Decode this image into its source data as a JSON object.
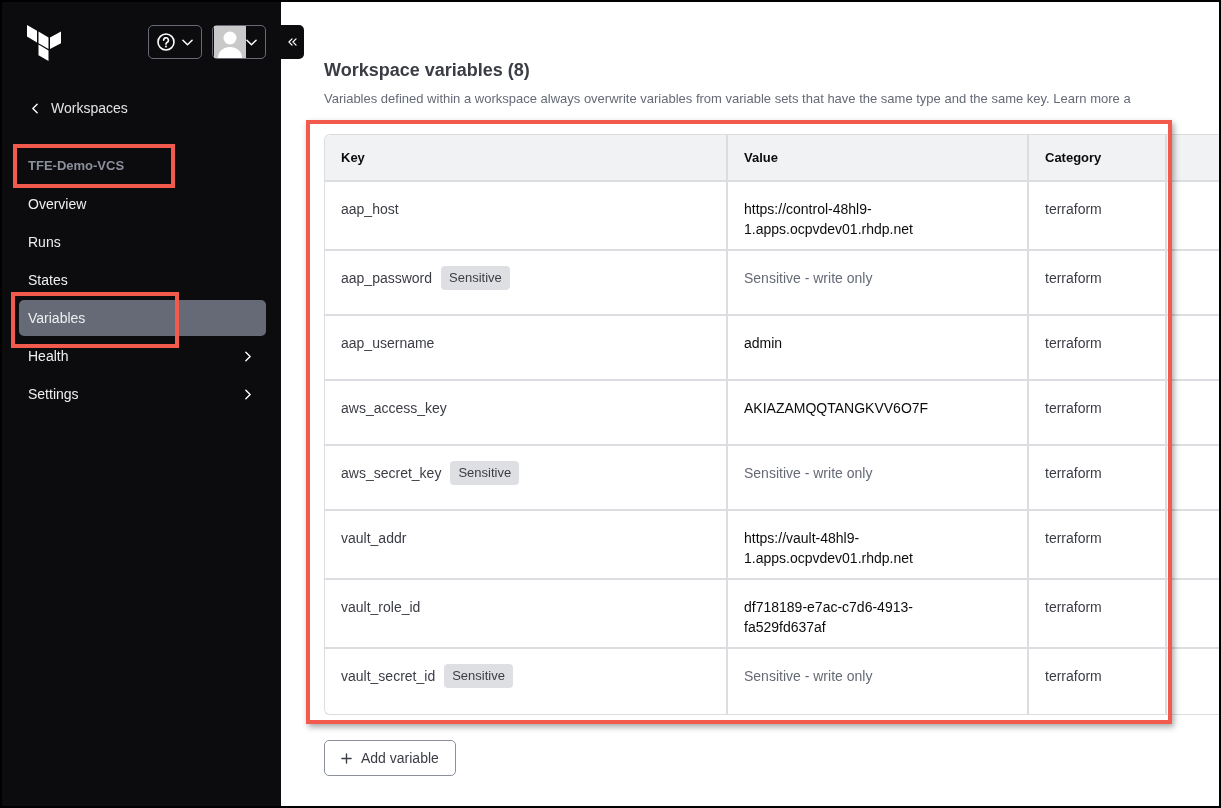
{
  "sidebar": {
    "back_link": {
      "label": "Workspaces"
    },
    "workspace": {
      "name": "TFE-Demo-VCS",
      "highlighted": true
    },
    "nav": [
      {
        "label": "Overview",
        "selected": false,
        "expandable": false,
        "highlighted": false
      },
      {
        "label": "Runs",
        "selected": false,
        "expandable": false,
        "highlighted": false
      },
      {
        "label": "States",
        "selected": false,
        "expandable": false,
        "highlighted": false
      },
      {
        "label": "Variables",
        "selected": true,
        "expandable": false,
        "highlighted": true
      },
      {
        "label": "Health",
        "selected": false,
        "expandable": true,
        "highlighted": false
      },
      {
        "label": "Settings",
        "selected": false,
        "expandable": true,
        "highlighted": false
      }
    ]
  },
  "section": {
    "title": "Workspace variables (8)",
    "description": "Variables defined within a workspace always overwrite variables from variable sets that have the same type and the same key. Learn more a"
  },
  "table": {
    "highlighted": true,
    "columns": [
      "Key",
      "Value",
      "Category"
    ],
    "rows": [
      {
        "key": "aap_host",
        "sensitive": false,
        "value": "https://control-48hl9-1.apps.ocpvdev01.rhdp.net",
        "category": "terraform"
      },
      {
        "key": "aap_password",
        "badge": "Sensitive",
        "sensitive": true,
        "value": "Sensitive - write only",
        "category": "terraform"
      },
      {
        "key": "aap_username",
        "sensitive": false,
        "value": "admin",
        "category": "terraform"
      },
      {
        "key": "aws_access_key",
        "sensitive": false,
        "value": "AKIAZAMQQTANGKVV6O7F",
        "category": "terraform"
      },
      {
        "key": "aws_secret_key",
        "badge": "Sensitive",
        "sensitive": true,
        "value": "Sensitive - write only",
        "category": "terraform"
      },
      {
        "key": "vault_addr",
        "sensitive": false,
        "value": "https://vault-48hl9-1.apps.ocpvdev01.rhdp.net",
        "category": "terraform"
      },
      {
        "key": "vault_role_id",
        "sensitive": false,
        "value": "df718189-e7ac-c7d6-4913-fa529fd637af",
        "category": "terraform"
      },
      {
        "key": "vault_secret_id",
        "badge": "Sensitive",
        "sensitive": true,
        "value": "Sensitive - write only",
        "category": "terraform"
      }
    ]
  },
  "add_button": {
    "label": "Add variable"
  }
}
